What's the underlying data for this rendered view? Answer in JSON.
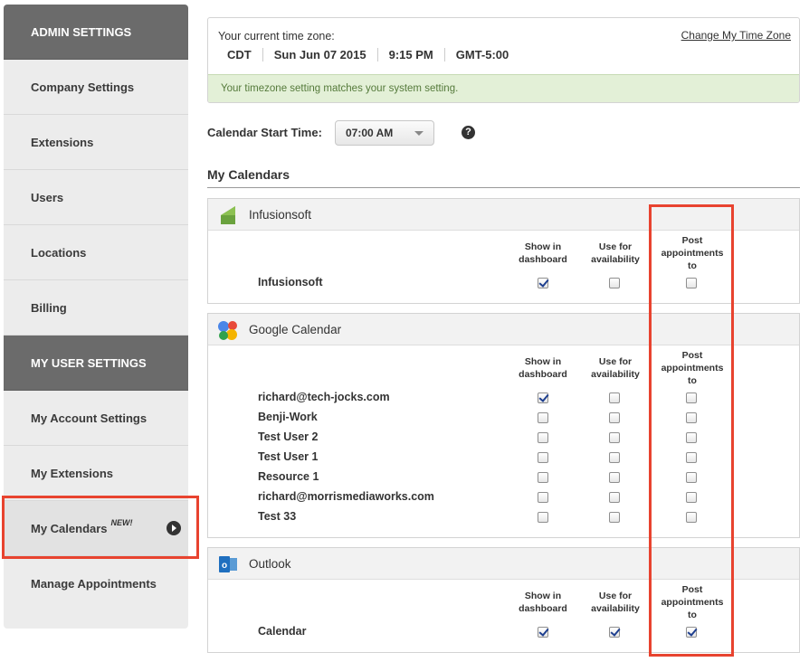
{
  "sidebar": {
    "items": [
      {
        "label": "ADMIN SETTINGS",
        "kind": "header"
      },
      {
        "label": "Company Settings"
      },
      {
        "label": "Extensions"
      },
      {
        "label": "Users"
      },
      {
        "label": "Locations"
      },
      {
        "label": "Billing"
      },
      {
        "label": "MY USER SETTINGS",
        "kind": "header"
      },
      {
        "label": "My Account Settings"
      },
      {
        "label": "My Extensions"
      },
      {
        "label": "My Calendars",
        "badge": "NEW!",
        "active": true
      },
      {
        "label": "Manage Appointments"
      }
    ]
  },
  "timezone": {
    "label": "Your current time zone:",
    "change_link": "Change My Time Zone",
    "zone": "CDT",
    "date": "Sun Jun 07 2015",
    "time": "9:15 PM",
    "offset": "GMT-5:00",
    "message": "Your timezone setting matches your system setting."
  },
  "calendar_start": {
    "label": "Calendar Start Time:",
    "value": "07:00 AM",
    "help": "?"
  },
  "my_calendars": {
    "title": "My Calendars",
    "column_headers": {
      "show": [
        "Show in",
        "dashboard"
      ],
      "use": [
        "Use for",
        "availability"
      ],
      "post": [
        "Post",
        "appointments",
        "to"
      ]
    },
    "providers": [
      {
        "name": "Infusionsoft",
        "icon": "infusionsoft-logo-icon",
        "calendars": [
          {
            "name": "Infusionsoft",
            "show": true,
            "use": false,
            "post": false
          }
        ]
      },
      {
        "name": "Google Calendar",
        "icon": "google-calendar-logo-icon",
        "calendars": [
          {
            "name": "richard@tech-jocks.com",
            "show": true,
            "use": false,
            "post": false
          },
          {
            "name": "Benji-Work",
            "show": false,
            "use": false,
            "post": false
          },
          {
            "name": "Test User 2",
            "show": false,
            "use": false,
            "post": false
          },
          {
            "name": "Test User 1",
            "show": false,
            "use": false,
            "post": false
          },
          {
            "name": "Resource 1",
            "show": false,
            "use": false,
            "post": false
          },
          {
            "name": "richard@morrismediaworks.com",
            "show": false,
            "use": false,
            "post": false
          },
          {
            "name": "Test 33",
            "show": false,
            "use": false,
            "post": false
          }
        ]
      },
      {
        "name": "Outlook",
        "icon": "outlook-logo-icon",
        "calendars": [
          {
            "name": "Calendar",
            "show": true,
            "use": true,
            "post": true
          }
        ]
      }
    ]
  },
  "colors": {
    "sidebar_header": "#6b6b6b",
    "highlight": "#e8432f",
    "success_bg": "#e3f0d7",
    "success_text": "#557a3b"
  }
}
